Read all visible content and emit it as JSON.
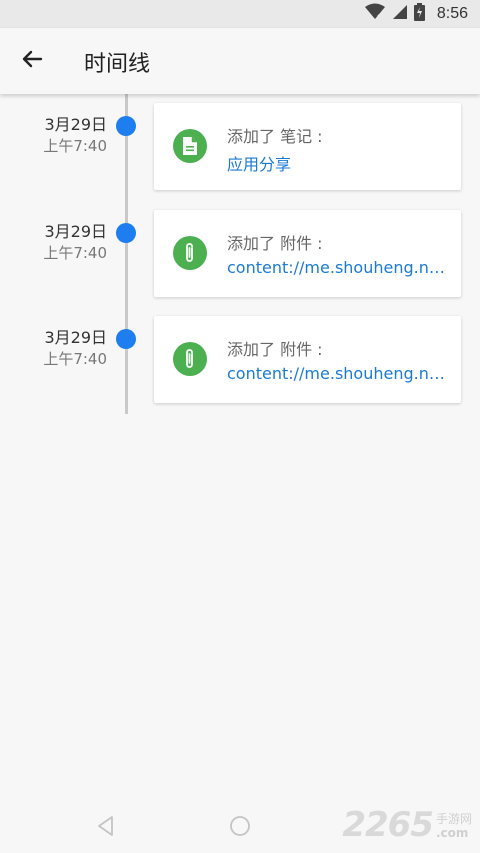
{
  "status_bar": {
    "time": "8:56",
    "icons": [
      "wifi-icon",
      "signal-icon",
      "battery-icon"
    ]
  },
  "app_bar": {
    "back_icon": "arrow-left-icon",
    "title": "时间线"
  },
  "timeline": {
    "entries": [
      {
        "date": "3月29日",
        "time": "上午7:40",
        "icon": "note-icon",
        "action": "添加了 笔记 :",
        "link": "应用分享"
      },
      {
        "date": "3月29日",
        "time": "上午7:40",
        "icon": "paperclip-icon",
        "action": "添加了 附件 :",
        "link": "content://me.shouheng.no…"
      },
      {
        "date": "3月29日",
        "time": "上午7:40",
        "icon": "paperclip-icon",
        "action": "添加了 附件 :",
        "link": "content://me.shouheng.no…"
      }
    ]
  },
  "nav_bar": {
    "icons": [
      "nav-back-icon",
      "nav-home-icon"
    ]
  },
  "watermark": {
    "number": "2265",
    "cn": "手游网",
    "com": ".com"
  },
  "colors": {
    "accent": "#1e7ef0",
    "link": "#1a7ad6",
    "icon_green": "#4caf50",
    "background": "#f7f7f7"
  }
}
